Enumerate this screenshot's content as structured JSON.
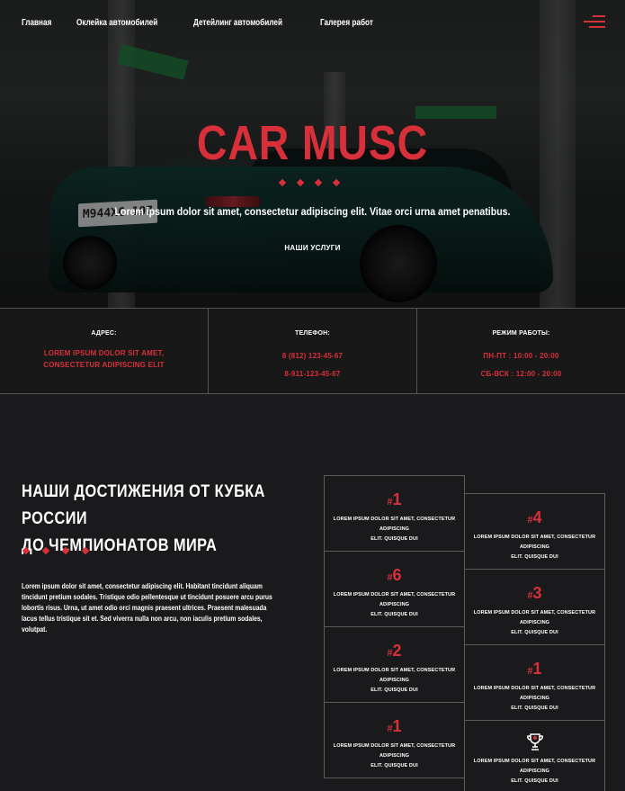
{
  "nav": {
    "items": [
      {
        "label": "Главная"
      },
      {
        "label": "Оклейка автомобилей"
      },
      {
        "label": "Детейлинг автомобилей"
      },
      {
        "label": "Галерея работ"
      }
    ]
  },
  "hero": {
    "plate_text": "М944ХС 197",
    "title": "CAR MUSC",
    "subtitle": "Lorem ipsum dolor sit amet, consectetur adipiscing elit. Vitae orci urna amet penatibus.",
    "button_label": "НАШИ УСЛУГИ"
  },
  "info": {
    "address": {
      "label": "АДРЕС:",
      "lines": [
        "LOREM IPSUM DOLOR SIT AMET,",
        "CONSECTETUR ADIPISCING ELIT"
      ]
    },
    "phone": {
      "label": "ТЕЛЕФОН:",
      "lines": [
        "8 (812) 123-45-67",
        "8-911-123-45-67"
      ]
    },
    "hours": {
      "label": "РЕЖИМ РАБОТЫ:",
      "lines": [
        "ПН-ПТ : 10:00 - 20:00",
        "СБ-ВСК : 12:00 - 20:00"
      ]
    }
  },
  "achievements": {
    "title_line1": "НАШИ ДОСТИЖЕНИЯ ОТ КУБКА РОССИИ",
    "title_line2": "ДО ЧЕМПИОНАТОВ МИРА",
    "text": "Lorem ipsum dolor sit amet, consectetur adipiscing elit. Habitant tincidunt aliquam tincidunt pretium sodales. Tristique odio pellentesque ut tincidunt posuere arcu purus lobortis risus. Urna, ut amet odio orci magnis praesent ultrices. Praesent malesuada lacus tellus tristique sit et. Sed viverra nulla non arcu, non iaculis pretium sodales, volutpat.",
    "cards_left": [
      {
        "hash": "#",
        "num": "1",
        "desc1": "LOREM IPSUM DOLOR SIT AMET, CONSECTETUR ADIPISCING",
        "desc2": "ELIT. QUISQUE DUI"
      },
      {
        "hash": "#",
        "num": "6",
        "desc1": "LOREM IPSUM DOLOR SIT AMET, CONSECTETUR ADIPISCING",
        "desc2": "ELIT. QUISQUE DUI"
      },
      {
        "hash": "#",
        "num": "2",
        "desc1": "LOREM IPSUM DOLOR SIT AMET, CONSECTETUR ADIPISCING",
        "desc2": "ELIT. QUISQUE DUI"
      },
      {
        "hash": "#",
        "num": "1",
        "desc1": "LOREM IPSUM DOLOR SIT AMET, CONSECTETUR ADIPISCING",
        "desc2": "ELIT. QUISQUE DUI"
      }
    ],
    "cards_right": [
      {
        "hash": "#",
        "num": "4",
        "desc1": "LOREM IPSUM DOLOR SIT AMET, CONSECTETUR ADIPISCING",
        "desc2": "ELIT. QUISQUE DUI"
      },
      {
        "hash": "#",
        "num": "3",
        "desc1": "LOREM IPSUM DOLOR SIT AMET, CONSECTETUR ADIPISCING",
        "desc2": "ELIT. QUISQUE DUI"
      },
      {
        "hash": "#",
        "num": "1",
        "desc1": "LOREM IPSUM DOLOR SIT AMET, CONSECTETUR ADIPISCING",
        "desc2": "ELIT. QUISQUE DUI"
      },
      {
        "icon": "trophy-icon",
        "desc1": "LOREM IPSUM DOLOR SIT AMET, CONSECTETUR ADIPISCING",
        "desc2": "ELIT. QUISQUE DUI"
      }
    ]
  },
  "colors": {
    "accent": "#d7303a",
    "background": "#1a1a1c",
    "border": "#5c5c5c"
  }
}
